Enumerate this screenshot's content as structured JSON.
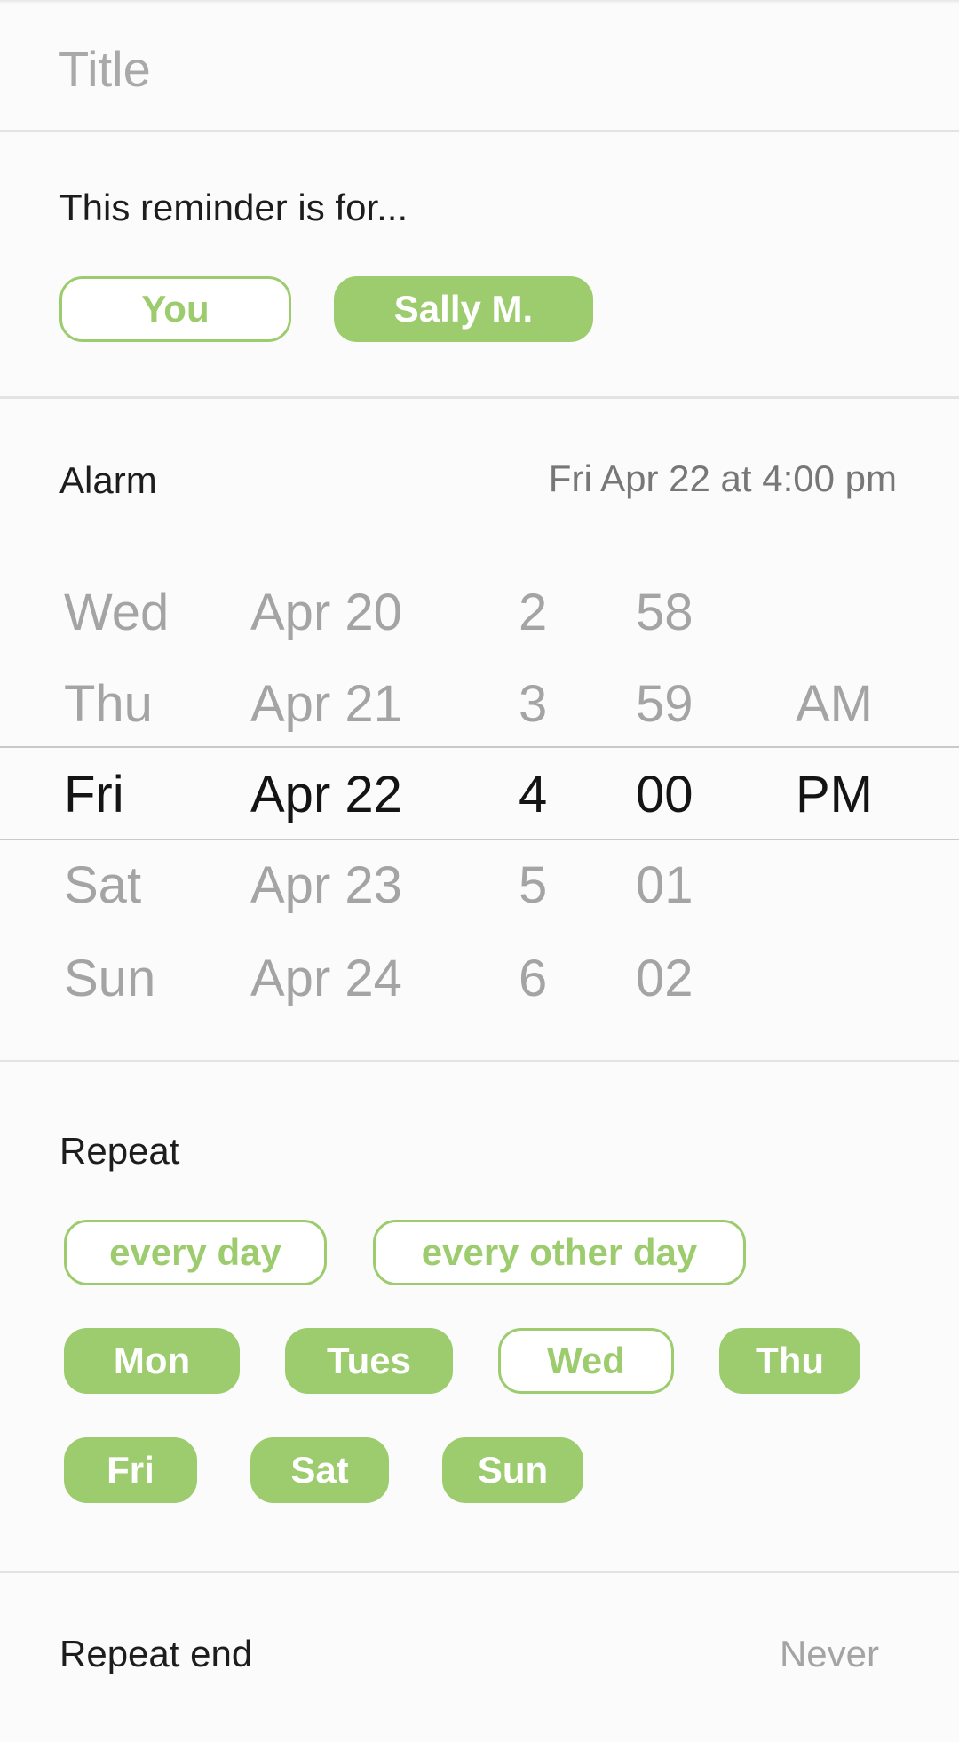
{
  "title_field": {
    "value": "",
    "placeholder": "Title"
  },
  "assignee": {
    "heading": "This reminder is for...",
    "options": [
      {
        "label": "You",
        "selected": false
      },
      {
        "label": "Sally M.",
        "selected": true
      }
    ]
  },
  "alarm": {
    "label": "Alarm",
    "summary": "Fri Apr 22 at 4:00 pm",
    "picker": {
      "weekday": [
        "Wed",
        "Thu",
        "Fri",
        "Sat",
        "Sun"
      ],
      "date": [
        "Apr 20",
        "Apr 21",
        "Apr 22",
        "Apr 23",
        "Apr 24"
      ],
      "hour": [
        "2",
        "3",
        "4",
        "5",
        "6"
      ],
      "minute": [
        "58",
        "59",
        "00",
        "01",
        "02"
      ],
      "meridiem": [
        "",
        "AM",
        "PM",
        "",
        ""
      ],
      "selected_index": 2
    }
  },
  "repeat": {
    "label": "Repeat",
    "presets": [
      {
        "label": "every day",
        "selected": false
      },
      {
        "label": "every other day",
        "selected": false
      }
    ],
    "days": [
      {
        "label": "Mon",
        "selected": true
      },
      {
        "label": "Tues",
        "selected": true
      },
      {
        "label": "Wed",
        "selected": false
      },
      {
        "label": "Thu",
        "selected": true
      },
      {
        "label": "Fri",
        "selected": true
      },
      {
        "label": "Sat",
        "selected": true
      },
      {
        "label": "Sun",
        "selected": true
      }
    ]
  },
  "repeat_end": {
    "label": "Repeat end",
    "value": "Never"
  },
  "colors": {
    "accent": "#9ccc6e",
    "background": "#fbfbfb",
    "muted_text": "#a4a4a4"
  }
}
